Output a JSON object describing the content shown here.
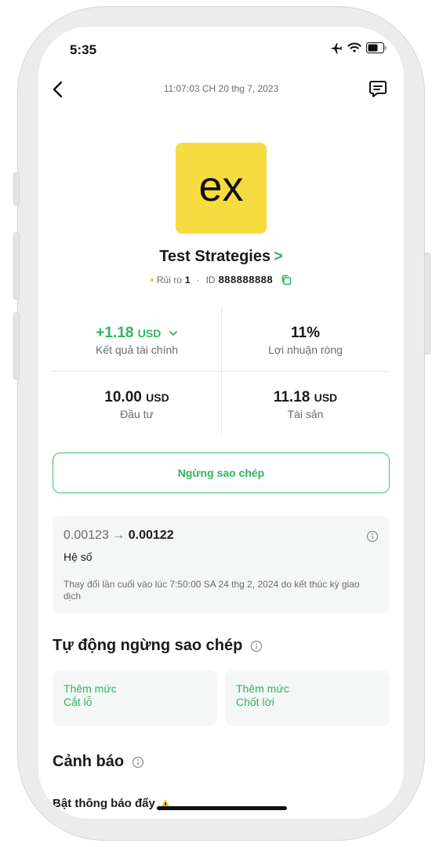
{
  "status_bar": {
    "time": "5:35"
  },
  "header": {
    "timestamp": "11:07:03 CH 20 thg 7, 2023"
  },
  "strategy": {
    "logo_text": "ex",
    "name": "Test Strategies",
    "chevron": ">",
    "risk_label": "Rủi ro",
    "risk_value": "1",
    "separator": "·",
    "id_label": "ID",
    "id_value": "888888888"
  },
  "stats": {
    "financial_result": {
      "value": "+1.18",
      "unit": "USD",
      "label": "Kết quả tài chính"
    },
    "net_profit": {
      "value": "11%",
      "label": "Lợi nhuận ròng"
    },
    "investment": {
      "value": "10.00",
      "unit": "USD",
      "label": "Đầu tư"
    },
    "assets": {
      "value": "11.18",
      "unit": "USD",
      "label": "Tài sản"
    }
  },
  "stop_copy_button": "Ngừng sao chép",
  "coefficient": {
    "old_value": "0.00123",
    "arrow": "→",
    "new_value": "0.00122",
    "label": "Hệ số",
    "note": "Thay đổi lần cuối vào lúc 7:50:00 SA 24 thg 2, 2024 do kết thúc kỳ giao dịch"
  },
  "auto_stop": {
    "title": "Tự động ngừng sao chép",
    "stop_loss": {
      "line1": "Thêm mức",
      "line2": "Cắt lỗ"
    },
    "take_profit": {
      "line1": "Thêm mức",
      "line2": "Chốt lời"
    }
  },
  "alerts": {
    "title": "Cảnh báo",
    "push_label": "Bật thông báo đẩy"
  },
  "colors": {
    "accent_green": "#2db561",
    "logo_yellow": "#f6dc40",
    "card_bg": "#f5f6f6"
  },
  "icons": [
    "back-arrow-icon",
    "chat-icon",
    "copy-icon",
    "info-icon",
    "warning-icon",
    "airplane-icon",
    "wifi-icon",
    "battery-icon",
    "chevron-down-icon"
  ]
}
